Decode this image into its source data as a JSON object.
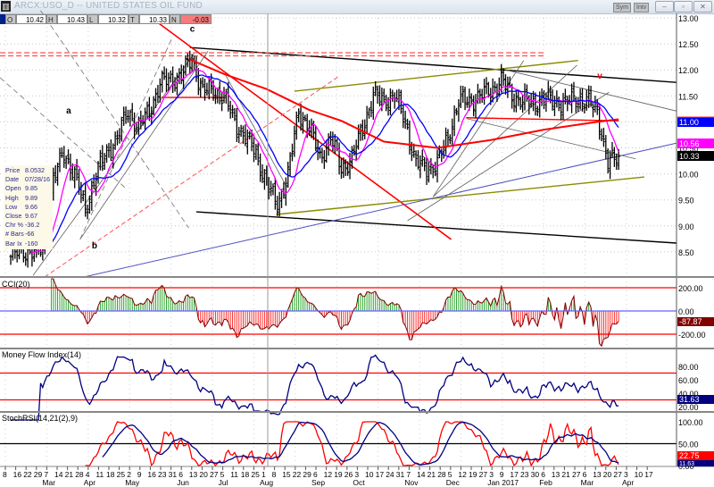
{
  "window": {
    "app_icon": "chart-app-icon",
    "title": "ARCX:USO_D -- UNITED STATES OIL FUND",
    "sym_button": "Sym",
    "intv_button": "Intv",
    "minimize": "–",
    "maximize": "▫",
    "close": "✕"
  },
  "quote": {
    "open_label": "O",
    "open": "10.42",
    "high_label": "H",
    "high": "10.43",
    "low_label": "L",
    "low": "10.32",
    "last_label": "T",
    "last": "10.33",
    "net_label": "N",
    "net": "-0.03"
  },
  "infobox": [
    {
      "k": "Price",
      "v": "8.0532"
    },
    {
      "k": "Date",
      "v": "07/28/16"
    },
    {
      "k": "Open",
      "v": "9.85"
    },
    {
      "k": "High",
      "v": "9.89"
    },
    {
      "k": "Low",
      "v": "9.66"
    },
    {
      "k": "Close",
      "v": "9.67"
    },
    {
      "k": "Chr %",
      "v": "-36.2"
    },
    {
      "k": "# Bars",
      "v": "-66"
    },
    {
      "k": "Bar Ix",
      "v": "-160"
    }
  ],
  "chart_data": {
    "type": "line",
    "title": "ARCX:USO_D -- UNITED STATES OIL FUND",
    "price": {
      "style": "ohlc",
      "ylim": [
        8.0,
        13.0
      ],
      "y_ticks": [
        "13.00",
        "12.50",
        "12.00",
        "11.50",
        "11.00",
        "10.50",
        "10.00",
        "9.50",
        "9.00",
        "8.50"
      ],
      "weekly_close": [
        8.41,
        8.53,
        8.5,
        8.55,
        9.9,
        10.4,
        10.0,
        9.3,
        10.0,
        10.4,
        10.7,
        11.2,
        10.9,
        11.2,
        11.75,
        11.8,
        11.9,
        12.2,
        11.6,
        11.6,
        11.5,
        11.0,
        10.7,
        10.4,
        9.8,
        9.4,
        10.0,
        11.2,
        10.9,
        10.3,
        10.7,
        10.1,
        10.3,
        10.9,
        11.5,
        11.4,
        11.5,
        11.0,
        10.2,
        10.1,
        10.2,
        10.7,
        11.4,
        11.4,
        11.5,
        11.6,
        11.8,
        11.5,
        11.4,
        11.35,
        11.45,
        11.4,
        11.35,
        11.45,
        11.4,
        11.2,
        10.2,
        10.33
      ],
      "fast_ma_period": 10,
      "slow_ma_period": 20,
      "long_ma": [
        [
          16.8,
          12.2
        ],
        [
          20,
          11.92
        ],
        [
          24,
          11.63
        ],
        [
          28,
          11.23
        ],
        [
          31,
          11.02
        ],
        [
          35,
          10.62
        ],
        [
          40,
          10.5
        ],
        [
          45,
          10.65
        ],
        [
          50,
          10.85
        ],
        [
          55,
          11.0
        ],
        [
          57,
          11.05
        ]
      ],
      "tags": [
        {
          "value": "11.00",
          "color": "#0000ff"
        },
        {
          "value": "10.56",
          "color": "#ff00ff"
        },
        {
          "value": "10.33",
          "color": "#000000"
        }
      ],
      "annotations": [
        {
          "text": "a",
          "week": 5.2,
          "price": 11.16,
          "color": "#000000"
        },
        {
          "text": "b",
          "week": 7.6,
          "price": 8.57,
          "color": "#000000"
        },
        {
          "text": "c",
          "week": 16.8,
          "price": 12.73,
          "color": "#000000"
        },
        {
          "text": "v",
          "week": 55,
          "price": 11.83,
          "color": "#ff0000"
        }
      ],
      "drawings": [
        {
          "name": "channel-top",
          "color": "#000000",
          "w": 1.4,
          "dash": "",
          "p": [
            [
              16.8,
              12.43
            ],
            [
              62.4,
              11.76
            ]
          ]
        },
        {
          "name": "channel-bottom",
          "color": "#000000",
          "w": 1.4,
          "dash": "",
          "p": [
            [
              17.4,
              9.27
            ],
            [
              62.4,
              8.67
            ]
          ]
        },
        {
          "name": "red-downtrend",
          "color": "#ff0000",
          "w": 1.6,
          "dash": "",
          "p": [
            [
              13.2,
              13.0
            ],
            [
              41.3,
              8.74
            ]
          ]
        },
        {
          "name": "red-dashed-resistance",
          "color": "#ff5050",
          "w": 1.2,
          "dash": "6,3",
          "p": [
            [
              -1,
              12.33
            ],
            [
              50,
              12.33
            ]
          ]
        },
        {
          "name": "red-dashed-resistance-2",
          "color": "#ff5050",
          "w": 1.2,
          "dash": "6,3",
          "p": [
            [
              -1,
              12.27
            ],
            [
              50,
              12.27
            ]
          ]
        },
        {
          "name": "red-dashed-support",
          "color": "#ff5050",
          "w": 1,
          "dash": "5,3",
          "p": [
            [
              3.2,
              8.02
            ],
            [
              30.8,
              11.88
            ]
          ]
        },
        {
          "name": "olive-upper",
          "color": "#8b8b00",
          "w": 1.4,
          "dash": "",
          "p": [
            [
              26.6,
              11.59
            ],
            [
              53.2,
              12.18
            ]
          ]
        },
        {
          "name": "olive-lower",
          "color": "#8b8b00",
          "w": 1.4,
          "dash": "",
          "p": [
            [
              24.9,
              9.22
            ],
            [
              59.4,
              9.94
            ]
          ]
        },
        {
          "name": "blue-support",
          "color": "#5050c0",
          "w": 1,
          "dash": "",
          "p": [
            [
              6.9,
              8.02
            ],
            [
              62.4,
              10.59
            ]
          ]
        },
        {
          "name": "gray-1",
          "color": "#606060",
          "w": 0.8,
          "dash": "",
          "p": [
            [
              46.4,
              12.0
            ],
            [
              62.4,
              11.21
            ]
          ]
        },
        {
          "name": "gray-2",
          "color": "#606060",
          "w": 0.8,
          "dash": "",
          "p": [
            [
              42.8,
              11.06
            ],
            [
              58.6,
              10.29
            ]
          ]
        },
        {
          "name": "gray-fan-1",
          "color": "#606060",
          "w": 0.8,
          "dash": "",
          "p": [
            [
              39.6,
              9.56
            ],
            [
              48.1,
              12.18
            ]
          ]
        },
        {
          "name": "gray-fan-2",
          "color": "#606060",
          "w": 0.8,
          "dash": "",
          "p": [
            [
              39.6,
              9.56
            ],
            [
              53.1,
              12.09
            ]
          ]
        },
        {
          "name": "gray-fan-3",
          "color": "#606060",
          "w": 0.8,
          "dash": "",
          "p": [
            [
              37.2,
              9.1
            ],
            [
              56.1,
              11.57
            ]
          ]
        },
        {
          "name": "gray-up-1",
          "color": "#606060",
          "w": 0.8,
          "dash": "",
          "p": [
            [
              2.1,
              8.05
            ],
            [
              17.2,
              12.31
            ]
          ]
        },
        {
          "name": "gray-up-2",
          "color": "#606060",
          "w": 0.8,
          "dash": "",
          "p": [
            [
              6.5,
              8.74
            ],
            [
              18.5,
              12.36
            ]
          ]
        },
        {
          "name": "gray-down-1",
          "color": "#606060",
          "w": 0.8,
          "dash": "",
          "p": [
            [
              20.2,
              11.88
            ],
            [
              25.9,
              9.74
            ]
          ]
        },
        {
          "name": "gray-dashed-1",
          "color": "#707070",
          "w": 0.8,
          "dash": "6,4",
          "p": [
            [
              2.8,
              13.14
            ],
            [
              16.7,
              8.96
            ]
          ]
        },
        {
          "name": "gray-dashed-2",
          "color": "#707070",
          "w": 0.8,
          "dash": "6,4",
          "p": [
            [
              -1,
              11.85
            ],
            [
              10.7,
              9.74
            ]
          ]
        },
        {
          "name": "gray-dashed-3",
          "color": "#707070",
          "w": 0.8,
          "dash": "6,4",
          "p": [
            [
              6.5,
              8.74
            ],
            [
              15.1,
              12.6
            ]
          ]
        },
        {
          "name": "red-neckline-1",
          "color": "#ff0000",
          "w": 1.4,
          "dash": "",
          "p": [
            [
              14.1,
              11.47
            ],
            [
              20.2,
              11.47
            ]
          ]
        },
        {
          "name": "red-neckline-2",
          "color": "#ff0000",
          "w": 1.4,
          "dash": "",
          "p": [
            [
              42.7,
              11.08
            ],
            [
              57,
              11.02
            ]
          ]
        }
      ]
    },
    "cci": {
      "title": "CCI(20)",
      "period": 20,
      "y_ticks": [
        "200.00",
        "0.00",
        "-200.00"
      ],
      "levels": [
        200,
        0,
        -200
      ],
      "last": "-87.87",
      "ylim": [
        -300,
        300
      ]
    },
    "mfi": {
      "title": "Money Flow Index(14)",
      "period": 14,
      "y_ticks": [
        "80.00",
        "60.00",
        "40.00",
        "20.00"
      ],
      "levels": [
        70,
        30
      ],
      "last": "31.63",
      "ylim": [
        0,
        100
      ]
    },
    "stochrsi": {
      "title": "StochRSI(14,21(2),9)",
      "y_ticks": [
        "100.00",
        "50.00",
        "0.00"
      ],
      "levels": [
        50
      ],
      "last_fast": "22.75",
      "last_slow": "11.63",
      "ylim": [
        0,
        100
      ]
    },
    "x_axis": {
      "day_ticks": [
        "8",
        "16",
        "22",
        "29",
        "7",
        "14",
        "21",
        "28",
        "4",
        "11",
        "18",
        "25",
        "2",
        "9",
        "16",
        "23",
        "31",
        "6",
        "13",
        "20",
        "27",
        "5",
        "11",
        "18",
        "25",
        "1",
        "8",
        "15",
        "22",
        "29",
        "6",
        "12",
        "19",
        "26",
        "3",
        "10",
        "17",
        "24",
        "31",
        "7",
        "14",
        "21",
        "28",
        "5",
        "12",
        "19",
        "27",
        "3",
        "9",
        "17",
        "23",
        "30",
        "6",
        "13",
        "21",
        "27",
        "6",
        "13",
        "20",
        "27",
        "3",
        "10",
        "17"
      ],
      "months": [
        {
          "label": "Mar",
          "tick": 4
        },
        {
          "label": "Apr",
          "tick": 8
        },
        {
          "label": "May",
          "tick": 12
        },
        {
          "label": "Jun",
          "tick": 17
        },
        {
          "label": "Jul",
          "tick": 21
        },
        {
          "label": "Aug",
          "tick": 25
        },
        {
          "label": "Sep",
          "tick": 30
        },
        {
          "label": "Oct",
          "tick": 34
        },
        {
          "label": "Nov",
          "tick": 39
        },
        {
          "label": "Dec",
          "tick": 43
        },
        {
          "label": "Jan 2017",
          "tick": 47
        },
        {
          "label": "Feb",
          "tick": 52
        },
        {
          "label": "Mar",
          "tick": 56
        },
        {
          "label": "Apr",
          "tick": 60
        }
      ]
    }
  }
}
